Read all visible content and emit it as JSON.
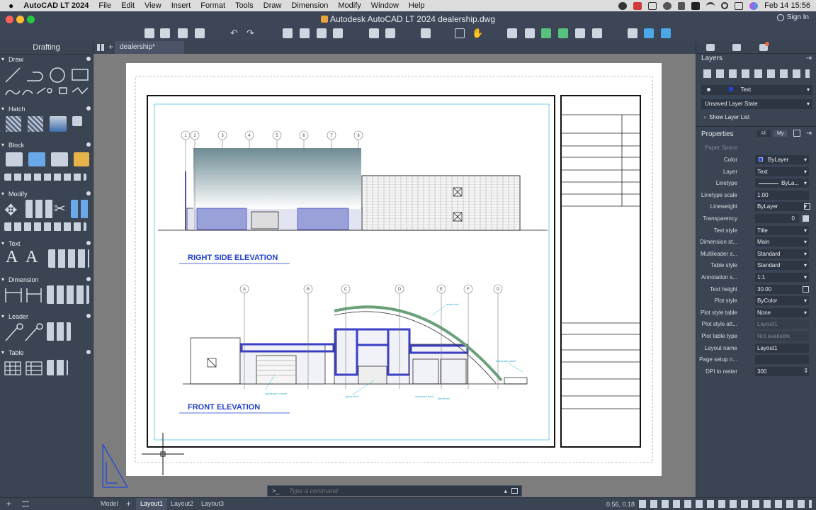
{
  "menubar": {
    "apple": "",
    "app": "AutoCAD LT 2024",
    "items": [
      "File",
      "Edit",
      "View",
      "Insert",
      "Format",
      "Tools",
      "Draw",
      "Dimension",
      "Modify",
      "Window",
      "Help"
    ],
    "clock": "Feb 14  15:56"
  },
  "window": {
    "title": "Autodesk AutoCAD LT 2024   dealership.dwg",
    "signin": "Sign In"
  },
  "left_palette": {
    "title": "Drafting",
    "sections": [
      "Draw",
      "Hatch",
      "Block",
      "Modify",
      "Text",
      "Dimension",
      "Leader",
      "Table"
    ]
  },
  "doc_tab": "dealership*",
  "drawing": {
    "title1": "RIGHT SIDE ELEVATION",
    "title2": "FRONT ELEVATION",
    "grid_top": [
      "1",
      "2",
      "3",
      "4",
      "5",
      "6",
      "7",
      "8"
    ],
    "grid_bottom": [
      "A",
      "B",
      "C",
      "D",
      "E",
      "F",
      "G"
    ],
    "notes": [
      "metal roof",
      "aluminum louvers",
      "glass door",
      "overhead door",
      "storefront",
      "aluminum panel"
    ]
  },
  "command": {
    "prompt": ">_",
    "placeholder": "Type a command"
  },
  "right_palette": {
    "layers_title": "Layers",
    "current_layer": "Text",
    "layer_state": "Unsaved Layer State",
    "show_layer_list": "Show Layer List",
    "properties_title": "Properties",
    "filter_all": "All",
    "filter_my": "My",
    "space": "Paper Space",
    "props": [
      {
        "label": "Color",
        "value": "ByLayer"
      },
      {
        "label": "Layer",
        "value": "Text"
      },
      {
        "label": "Linetype",
        "value": "ByLa..."
      },
      {
        "label": "Linetype scale",
        "value": "1.00"
      },
      {
        "label": "Lineweight",
        "value": "ByLayer"
      },
      {
        "label": "Transparency",
        "value": "0"
      },
      {
        "label": "Text style",
        "value": "Title"
      },
      {
        "label": "Dimension st...",
        "value": "Main"
      },
      {
        "label": "Multileader s...",
        "value": "Standard"
      },
      {
        "label": "Table style",
        "value": "Standard"
      },
      {
        "label": "Annotation s...",
        "value": "1:1"
      },
      {
        "label": "Text height",
        "value": "30.00"
      },
      {
        "label": "Plot style",
        "value": "ByColor"
      },
      {
        "label": "Plot style table",
        "value": "None"
      },
      {
        "label": "Plot style att...",
        "value": "Layout1"
      },
      {
        "label": "Plot table type",
        "value": "Not available"
      },
      {
        "label": "Layout name",
        "value": "Layout1"
      },
      {
        "label": "Page setup n...",
        "value": ""
      },
      {
        "label": "DPI to raster",
        "value": "300"
      }
    ]
  },
  "status": {
    "tabs": [
      "Model",
      "Layout1",
      "Layout2",
      "Layout3"
    ],
    "coords": "0.56,  0.18"
  },
  "colors": {
    "accent_blue": "#1f3fc9",
    "cyan": "#28b8d8",
    "panel": "#3b4453"
  }
}
